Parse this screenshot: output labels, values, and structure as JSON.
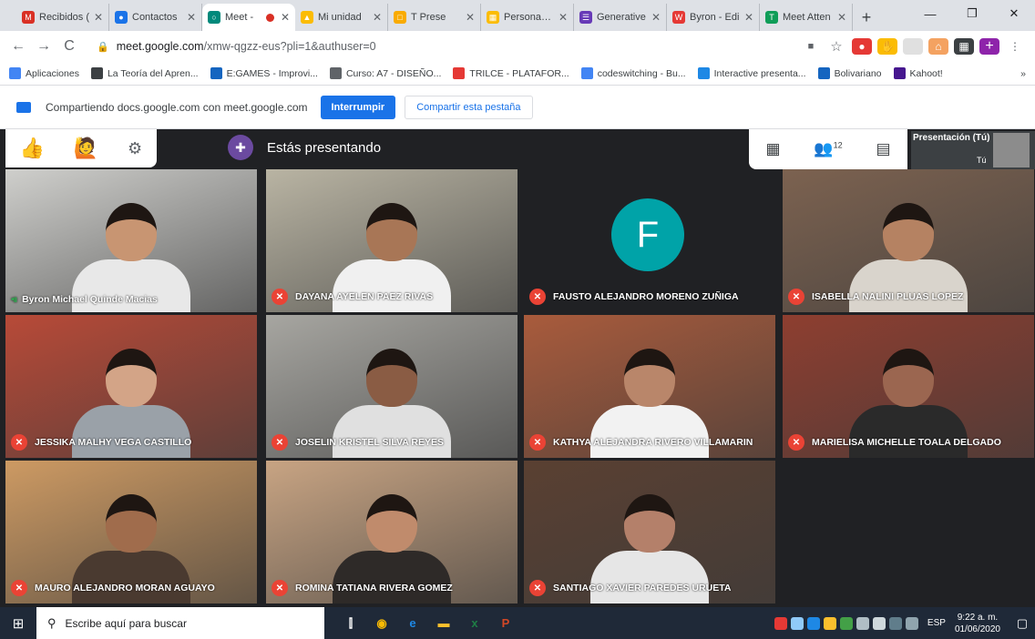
{
  "browser": {
    "tabs": [
      {
        "label": "Recibidos (",
        "color": "#d93025",
        "letter": "M",
        "active": false,
        "rec": false
      },
      {
        "label": "Contactos",
        "color": "#1a73e8",
        "letter": "●",
        "active": false,
        "rec": false
      },
      {
        "label": "Meet -",
        "color": "#00897b",
        "letter": "○",
        "active": true,
        "rec": true
      },
      {
        "label": "Mi unidad",
        "color": "#fbbc04",
        "letter": "▲",
        "active": false,
        "rec": false
      },
      {
        "label": "T Prese",
        "color": "#f9ab00",
        "letter": "□",
        "active": false,
        "rec": false
      },
      {
        "label": "Personas en",
        "color": "#fbbc04",
        "letter": "▦",
        "active": false,
        "rec": false
      },
      {
        "label": "Generative",
        "color": "#673ab7",
        "letter": "☰",
        "active": false,
        "rec": false
      },
      {
        "label": "Byron - Edi",
        "color": "#e53935",
        "letter": "W",
        "active": false,
        "rec": false
      },
      {
        "label": "Meet Atten",
        "color": "#0f9d58",
        "letter": "T",
        "active": false,
        "rec": false
      }
    ],
    "close_glyph": "✕",
    "newtab_glyph": "+",
    "window_controls": {
      "minimize": "—",
      "restore": "❐",
      "close": "✕"
    },
    "nav": {
      "back": "←",
      "forward": "→",
      "reload": "C"
    },
    "url_host": "meet.google.com",
    "url_path": "/xmw-qgzz-eus?pli=1&authuser=0",
    "lock_glyph": "🔒",
    "star_glyph": "☆",
    "bookmarks": [
      {
        "label": "Aplicaciones",
        "color": "#4285f4"
      },
      {
        "label": "La Teoría del Apren...",
        "color": "#3c4043"
      },
      {
        "label": "E:GAMES - Improvi...",
        "color": "#1565c0"
      },
      {
        "label": "Curso: A7 - DISEÑO...",
        "color": "#5f6368"
      },
      {
        "label": "TRILCE - PLATAFOR...",
        "color": "#e53935"
      },
      {
        "label": "codeswitching - Bu...",
        "color": "#4285f4"
      },
      {
        "label": "Interactive presenta...",
        "color": "#1e88e5"
      },
      {
        "label": "Bolivariano",
        "color": "#1565c0"
      },
      {
        "label": "Kahoot!",
        "color": "#46178f"
      }
    ],
    "bookmarks_more": "»"
  },
  "share_bar": {
    "text": "Compartiendo docs.google.com con meet.google.com",
    "stop_label": "Interrumpir",
    "share_tab_label": "Compartir esta pestaña"
  },
  "meet": {
    "reactions": [
      "👍",
      "🙋",
      "⚙"
    ],
    "presenting_label": "Estás presentando",
    "participant_count": "12",
    "controls": {
      "grid": "▦",
      "people": "👥",
      "chat": "▤"
    },
    "self_label": "Presentación (Tú)",
    "self_name": "Tú",
    "tiles": [
      {
        "name": "Byron Michael Quinde Macias",
        "muted": false,
        "bg": "#cfcfcc",
        "skin": "#c89572",
        "shirt": "#e8e8e8",
        "avatar": ""
      },
      {
        "name": "DAYANA AYELEN PAEZ RIVAS",
        "muted": true,
        "bg": "#b9b4a3",
        "skin": "#a87656",
        "shirt": "#f0f0f0",
        "avatar": ""
      },
      {
        "name": "FAUSTO ALEJANDRO MORENO ZUÑIGA",
        "muted": true,
        "bg": "#202124",
        "skin": "",
        "shirt": "",
        "avatar": "F"
      },
      {
        "name": "ISABELLA NALINI PLUAS LOPEZ",
        "muted": true,
        "bg": "#7c6250",
        "skin": "#b58262",
        "shirt": "#d9d4cc",
        "avatar": ""
      },
      {
        "name": "JESSIKA MALHY VEGA CASTILLO",
        "muted": true,
        "bg": "#b84a38",
        "skin": "#d3a487",
        "shirt": "#9aa1a8",
        "avatar": ""
      },
      {
        "name": "JOSELIN KRISTEL SILVA REYES",
        "muted": true,
        "bg": "#a7a6a1",
        "skin": "#8a5c44",
        "shirt": "#e0e0e0",
        "avatar": ""
      },
      {
        "name": "KATHYA ALEJANDRA RIVERO VILLAMARIN",
        "muted": true,
        "bg": "#a95b3c",
        "skin": "#b9866a",
        "shirt": "#f2f2f2",
        "avatar": ""
      },
      {
        "name": "MARIELISA MICHELLE TOALA DELGADO",
        "muted": true,
        "bg": "#8e3e30",
        "skin": "#9b6650",
        "shirt": "#2a2a2a",
        "avatar": ""
      },
      {
        "name": "MAURO ALEJANDRO MORAN AGUAYO",
        "muted": true,
        "bg": "#cd9a63",
        "skin": "#a06c4c",
        "shirt": "#4a3a30",
        "avatar": ""
      },
      {
        "name": "ROMINA TATIANA RIVERA GOMEZ",
        "muted": true,
        "bg": "#c8a483",
        "skin": "#c08b6c",
        "shirt": "#2e2a28",
        "avatar": ""
      },
      {
        "name": "SANTIAGO XAVIER PAREDES URUETA",
        "muted": true,
        "bg": "#5a4032",
        "skin": "#b4806a",
        "shirt": "#e6e6e6",
        "avatar": ""
      }
    ],
    "mic_off_glyph": "✕",
    "speaking_glyph": "•ıı"
  },
  "taskbar": {
    "start_glyph": "⊞",
    "search_placeholder": "Escribe aquí para buscar",
    "search_glyph": "⚲",
    "apps": [
      {
        "glyph": "⫿",
        "color": "#ffffff"
      },
      {
        "glyph": "◉",
        "color": "#fbbc04"
      },
      {
        "glyph": "e",
        "color": "#1e88e5"
      },
      {
        "glyph": "▬",
        "color": "#fbc02d"
      },
      {
        "glyph": "x",
        "color": "#1e7e45"
      },
      {
        "glyph": "P",
        "color": "#d24726"
      }
    ],
    "language": "ESP",
    "time": "9:22 a. m.",
    "date": "01/06/2020",
    "notification_glyph": "▢"
  }
}
